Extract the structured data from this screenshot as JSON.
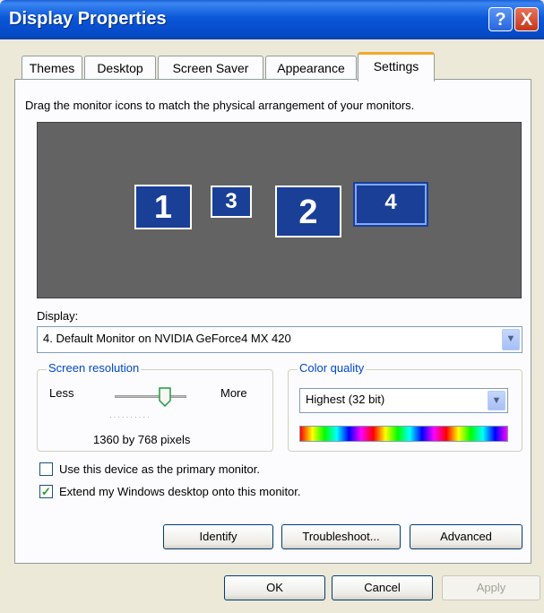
{
  "window": {
    "title": "Display Properties",
    "help": "?",
    "close": "X"
  },
  "tabs": [
    "Themes",
    "Desktop",
    "Screen Saver",
    "Appearance",
    "Settings"
  ],
  "active_tab": "Settings",
  "instruction": "Drag the monitor icons to match the physical arrangement of your monitors.",
  "monitors": [
    "1",
    "3",
    "2",
    "4"
  ],
  "selected_monitor": "4",
  "display": {
    "label": "Display:",
    "value": "4. Default Monitor on NVIDIA GeForce4 MX 420"
  },
  "resolution": {
    "title": "Screen resolution",
    "less": "Less",
    "more": "More",
    "value": "1360 by 768 pixels"
  },
  "color_quality": {
    "title": "Color quality",
    "value": "Highest (32 bit)"
  },
  "checkboxes": {
    "primary": {
      "label": "Use this device as the primary monitor.",
      "checked": false
    },
    "extend": {
      "label": "Extend my Windows desktop onto this monitor.",
      "checked": true
    }
  },
  "buttons": {
    "identify": "Identify",
    "troubleshoot": "Troubleshoot...",
    "advanced": "Advanced",
    "ok": "OK",
    "cancel": "Cancel",
    "apply": "Apply"
  },
  "icons": {
    "checkmark": "✓",
    "dropdown": "▼"
  }
}
